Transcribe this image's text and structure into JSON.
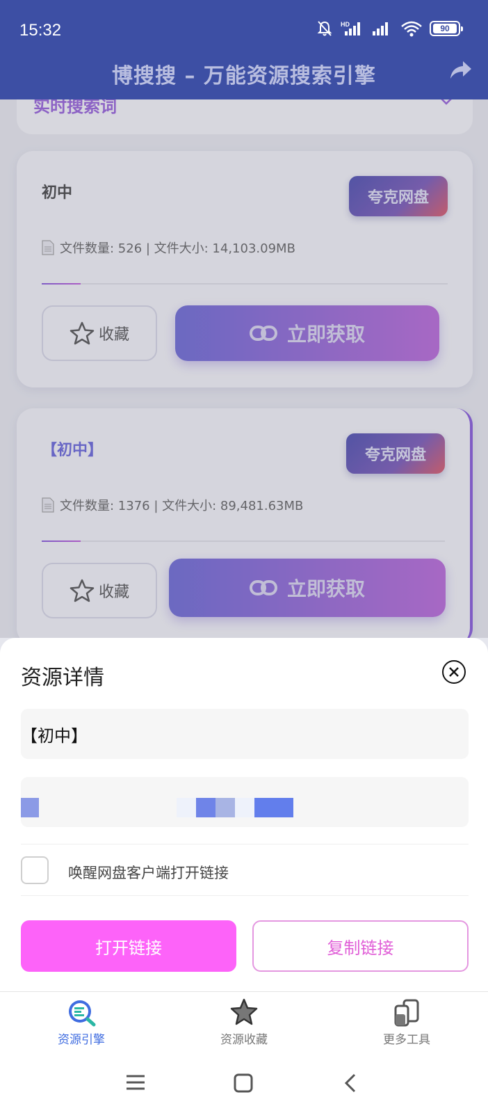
{
  "status_bar": {
    "time": "15:32",
    "battery": "90",
    "hd_label": "HD"
  },
  "header": {
    "title": "博搜搜 – 万能资源搜索引擎",
    "share_icon": "share-icon"
  },
  "search_card": {
    "label": "实时搜索词"
  },
  "cards": [
    {
      "title": "初中",
      "tag": "夸克网盘",
      "info": "文件数量: 526 | 文件大小: 14,103.09MB",
      "fav_label": "收藏",
      "get_label": "立即获取"
    },
    {
      "title": "【初中】",
      "tag": "夸克网盘",
      "info": "文件数量: 1376 | 文件大小: 89,481.63MB",
      "fav_label": "收藏",
      "get_label": "立即获取"
    }
  ],
  "sheet": {
    "title": "资源详情",
    "resource_name": "【初中】",
    "checkbox_label": "唤醒网盘客户端打开链接",
    "checkbox_checked": false,
    "open_button": "打开链接",
    "copy_button": "复制链接"
  },
  "bottom_nav": [
    {
      "label": "资源引擎",
      "icon": "search-engine-icon",
      "active": true
    },
    {
      "label": "资源收藏",
      "icon": "star-icon",
      "active": false
    },
    {
      "label": "更多工具",
      "icon": "tools-icon",
      "active": false
    }
  ],
  "colors": {
    "header": "#3d4fa4",
    "accent_purple": "#8d5ad2",
    "open_button": "#fd63f9",
    "copy_button_text": "#e05ed7",
    "nav_active": "#3f6ce0"
  }
}
